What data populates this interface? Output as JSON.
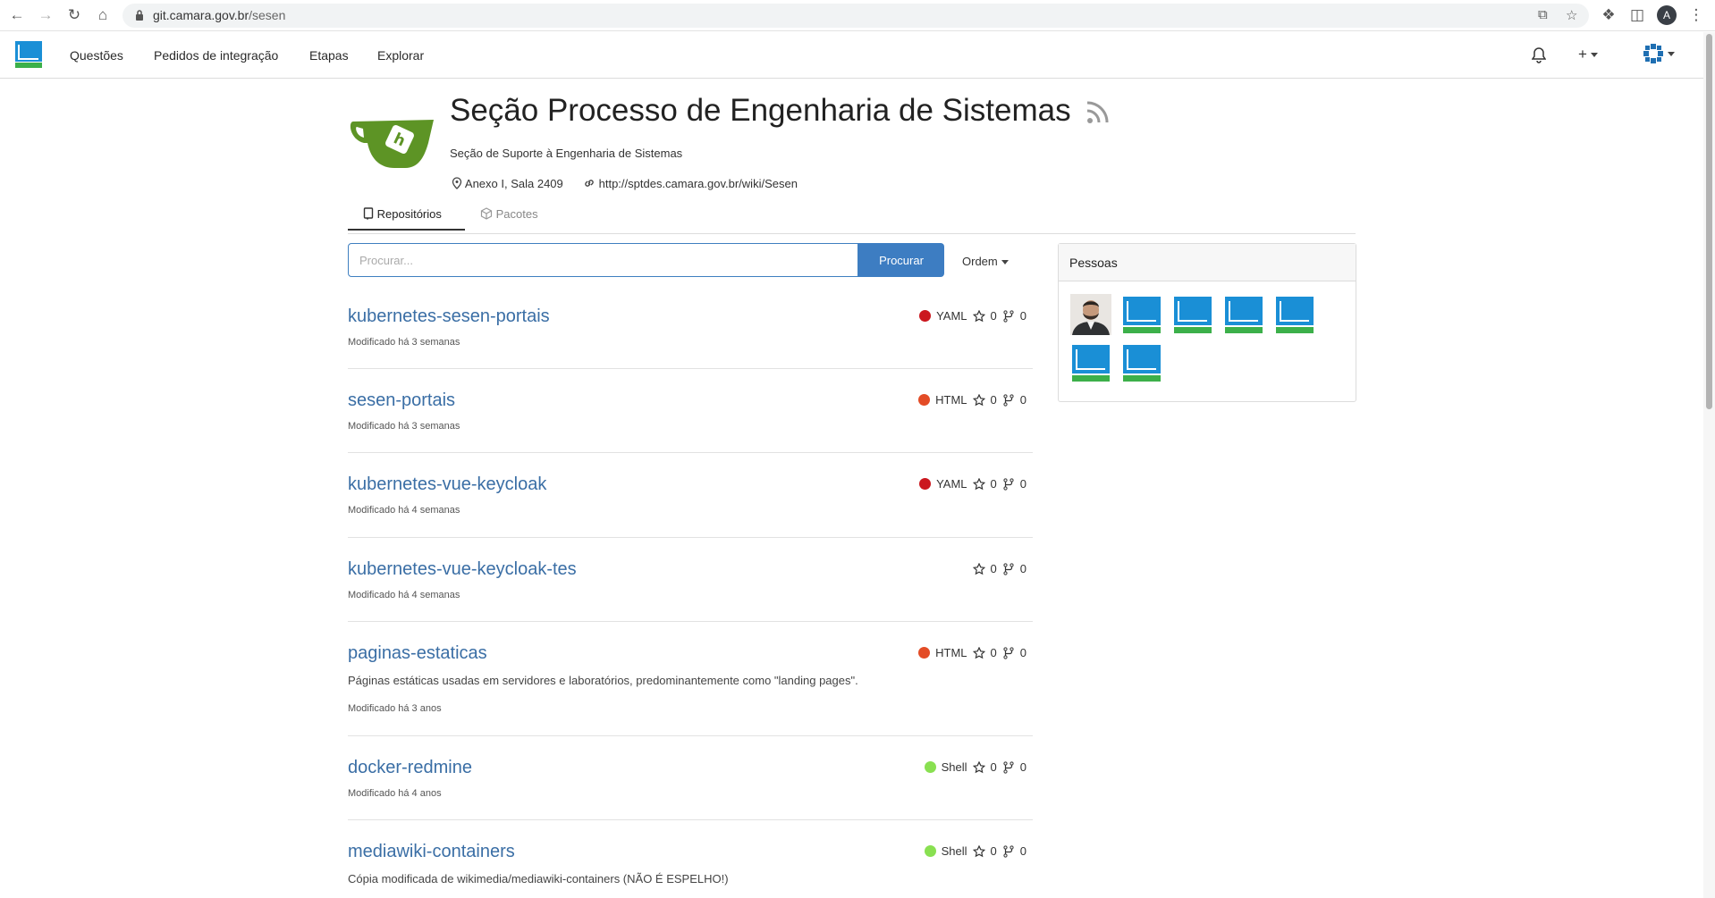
{
  "browser": {
    "url_host": "git.camara.gov.br",
    "url_path": "/sesen",
    "profile_initial": "A"
  },
  "nav": {
    "items": [
      {
        "label": "Questões"
      },
      {
        "label": "Pedidos de integração"
      },
      {
        "label": "Etapas"
      },
      {
        "label": "Explorar"
      }
    ],
    "plus_label": "+"
  },
  "org": {
    "title": "Seção Processo de Engenharia de Sistemas",
    "description": "Seção de Suporte à Engenharia de Sistemas",
    "location": "Anexo I, Sala 2409",
    "website": "http://sptdes.camara.gov.br/wiki/Sesen"
  },
  "tabs": [
    {
      "label": "Repositórios",
      "active": true
    },
    {
      "label": "Pacotes",
      "active": false
    }
  ],
  "search": {
    "placeholder": "Procurar...",
    "button": "Procurar",
    "sort": "Ordem"
  },
  "repos": [
    {
      "name": "kubernetes-sesen-portais",
      "desc": "",
      "modified": "Modificado há 3 semanas",
      "lang": "YAML",
      "lang_color": "#cb171e",
      "stars": "0",
      "forks": "0"
    },
    {
      "name": "sesen-portais",
      "desc": "",
      "modified": "Modificado há 3 semanas",
      "lang": "HTML",
      "lang_color": "#e34c26",
      "stars": "0",
      "forks": "0"
    },
    {
      "name": "kubernetes-vue-keycloak",
      "desc": "",
      "modified": "Modificado há 4 semanas",
      "lang": "YAML",
      "lang_color": "#cb171e",
      "stars": "0",
      "forks": "0"
    },
    {
      "name": "kubernetes-vue-keycloak-tes",
      "desc": "",
      "modified": "Modificado há 4 semanas",
      "lang": "",
      "lang_color": "",
      "stars": "0",
      "forks": "0"
    },
    {
      "name": "paginas-estaticas",
      "desc": "Páginas estáticas usadas em servidores e laboratórios, predominantemente como \"landing pages\".",
      "modified": "Modificado há 3 anos",
      "lang": "HTML",
      "lang_color": "#e34c26",
      "stars": "0",
      "forks": "0"
    },
    {
      "name": "docker-redmine",
      "desc": "",
      "modified": "Modificado há 4 anos",
      "lang": "Shell",
      "lang_color": "#89e051",
      "stars": "0",
      "forks": "0"
    },
    {
      "name": "mediawiki-containers",
      "desc": "Cópia modificada de wikimedia/mediawiki-containers (NÃO É ESPELHO!)",
      "modified": "",
      "lang": "Shell",
      "lang_color": "#89e051",
      "stars": "0",
      "forks": "0"
    }
  ],
  "people": {
    "title": "Pessoas",
    "members": [
      "photo",
      "logo",
      "logo",
      "logo",
      "logo",
      "logo",
      "logo"
    ]
  },
  "colors": {
    "link": "#3a6ea5",
    "primary_button": "#3d7dc2",
    "gitea_green": "#609926"
  }
}
